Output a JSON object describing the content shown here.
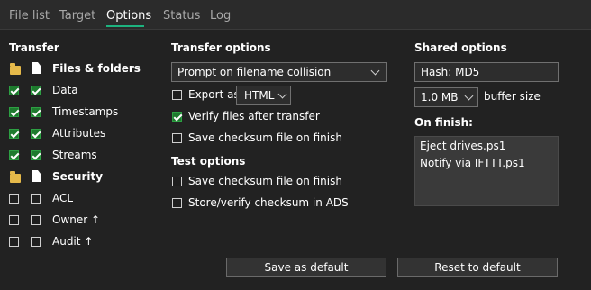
{
  "tabs": [
    "File list",
    "Target",
    "Options",
    "Status",
    "Log"
  ],
  "transfer": {
    "heading": "Transfer",
    "files_folders": "Files & folders",
    "data": "Data",
    "timestamps": "Timestamps",
    "attributes": "Attributes",
    "streams": "Streams",
    "security": "Security",
    "acl": "ACL",
    "owner": "Owner",
    "audit": "Audit",
    "elevation_mark": "↑"
  },
  "transfer_options": {
    "heading": "Transfer options",
    "collision_value": "Prompt on filename collision",
    "export_label": "Export as",
    "export_format": "HTML",
    "verify_label": "Verify files after transfer",
    "save_checksum_label": "Save checksum file on finish"
  },
  "test_options": {
    "heading": "Test options",
    "save_checksum_label": "Save checksum file on finish",
    "store_verify_label": "Store/verify checksum in ADS"
  },
  "shared_options": {
    "heading": "Shared options",
    "hash_value": "Hash: MD5",
    "buffer_value": "1.0 MB",
    "buffer_label": "buffer size",
    "on_finish_label": "On finish:",
    "on_finish_items": [
      "Eject drives.ps1",
      "Notify via IFTTT.ps1"
    ]
  },
  "buttons": {
    "save_default": "Save as default",
    "reset_default": "Reset to default"
  },
  "colors": {
    "accent": "#1db37f",
    "checkbox_checked": "#1e7a2e",
    "folder": "#e5b94a"
  }
}
